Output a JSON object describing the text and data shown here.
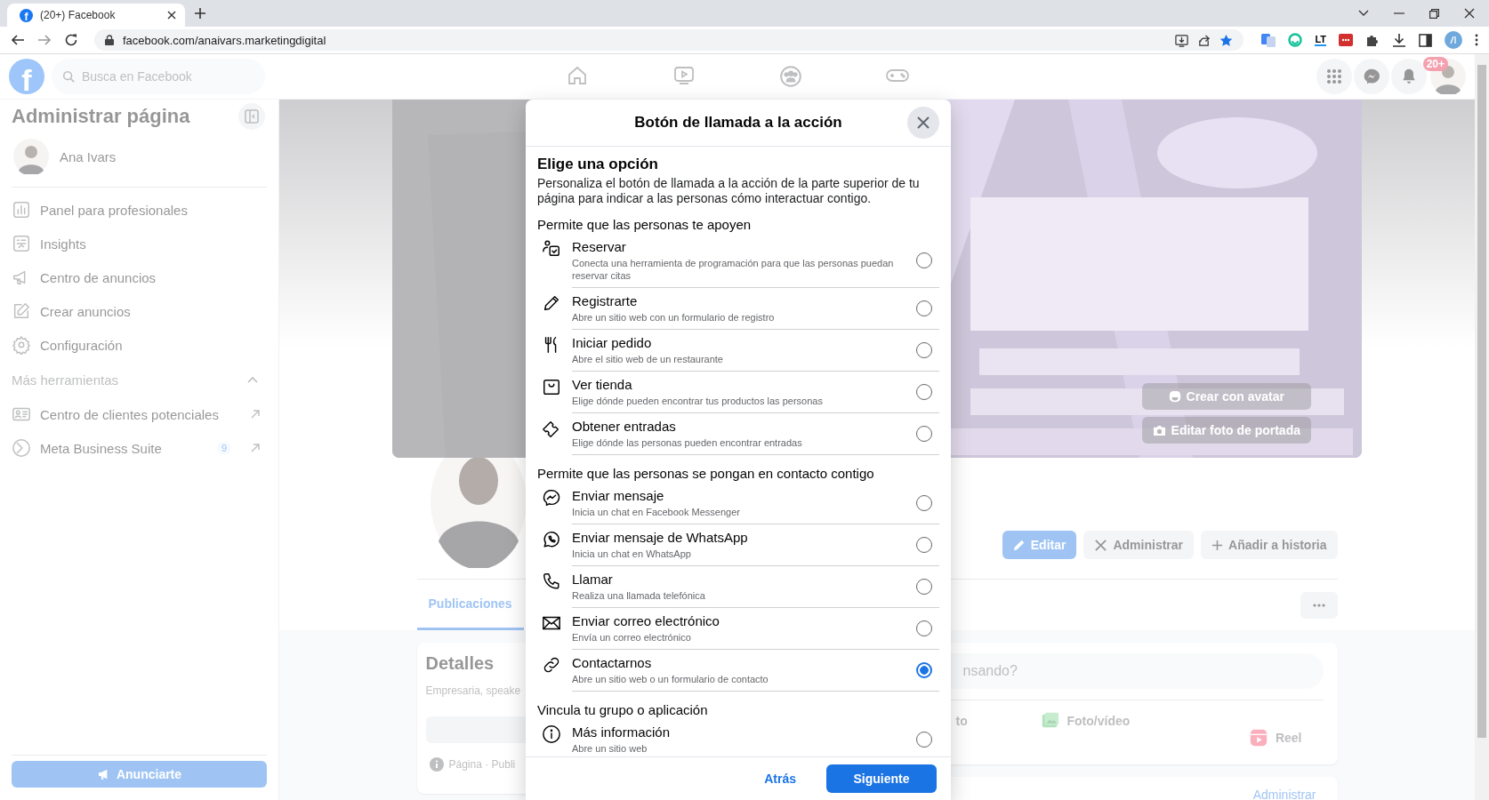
{
  "browser": {
    "favicon_letter": "f",
    "tab_title": "(20+) Facebook",
    "url": "facebook.com/anaivars.marketingdigital",
    "extension_label": "LT"
  },
  "topbar": {
    "logo_letter": "f",
    "search_placeholder": "Busca en Facebook",
    "notification_badge": "20+"
  },
  "sidebar": {
    "title": "Administrar página",
    "profile_name": "Ana Ivars",
    "items": [
      {
        "label": "Panel para profesionales"
      },
      {
        "label": "Insights"
      },
      {
        "label": "Centro de anuncios"
      },
      {
        "label": "Crear anuncios"
      },
      {
        "label": "Configuración"
      }
    ],
    "section": {
      "title": "Más herramientas",
      "expanded": true,
      "items": [
        {
          "label": "Centro de clientes potenciales"
        },
        {
          "label": "Meta Business Suite",
          "badge": "9"
        }
      ]
    },
    "button": "Anunciarte"
  },
  "page": {
    "cover_buttons": [
      "Crear con avatar",
      "Editar foto de portada"
    ],
    "actions": [
      {
        "label": "Editar",
        "kind": "primary"
      },
      {
        "label": "Administrar",
        "kind": "secondary"
      },
      {
        "label": "Añadir a historia",
        "kind": "secondary"
      }
    ],
    "tabs": [
      {
        "label": "Publicaciones",
        "selected": true
      }
    ],
    "details": {
      "title": "Detalles",
      "text": "Empresaria, speake",
      "footer": "Página · Publi"
    },
    "composer": {
      "placeholder": "nsando?",
      "actions": [
        "to",
        "Foto/vídeo",
        "Reel"
      ]
    },
    "card_link": "Administrar"
  },
  "modal": {
    "title": "Botón de llamada a la acción",
    "heading": "Elige una opción",
    "description": "Personaliza el botón de llamada a la acción de la parte superior de tu página para indicar a las personas cómo interactuar contigo.",
    "sections": [
      {
        "title": "Permite que las personas te apoyen",
        "options": [
          {
            "title": "Reservar",
            "description": "Conecta una herramienta de programación para que las personas puedan reservar citas",
            "selected": false
          },
          {
            "title": "Registrarte",
            "description": "Abre un sitio web con un formulario de registro",
            "selected": false
          },
          {
            "title": "Iniciar pedido",
            "description": "Abre el sitio web de un restaurante",
            "selected": false
          },
          {
            "title": "Ver tienda",
            "description": "Elige dónde pueden encontrar tus productos las personas",
            "selected": false
          },
          {
            "title": "Obtener entradas",
            "description": "Elige dónde las personas pueden encontrar entradas",
            "selected": false
          }
        ]
      },
      {
        "title": "Permite que las personas se pongan en contacto contigo",
        "options": [
          {
            "title": "Enviar mensaje",
            "description": "Inicia un chat en Facebook Messenger",
            "selected": false
          },
          {
            "title": "Enviar mensaje de WhatsApp",
            "description": "Inicia un chat en WhatsApp",
            "selected": false
          },
          {
            "title": "Llamar",
            "description": "Realiza una llamada telefónica",
            "selected": false
          },
          {
            "title": "Enviar correo electrónico",
            "description": "Envía un correo electrónico",
            "selected": false
          },
          {
            "title": "Contactarnos",
            "description": "Abre un sitio web o un formulario de contacto",
            "selected": true
          }
        ]
      },
      {
        "title": "Vincula tu grupo o aplicación",
        "options": [
          {
            "title": "Más información",
            "description": "Abre un sitio web",
            "selected": false
          }
        ]
      }
    ],
    "back": "Atrás",
    "next": "Siguiente"
  }
}
